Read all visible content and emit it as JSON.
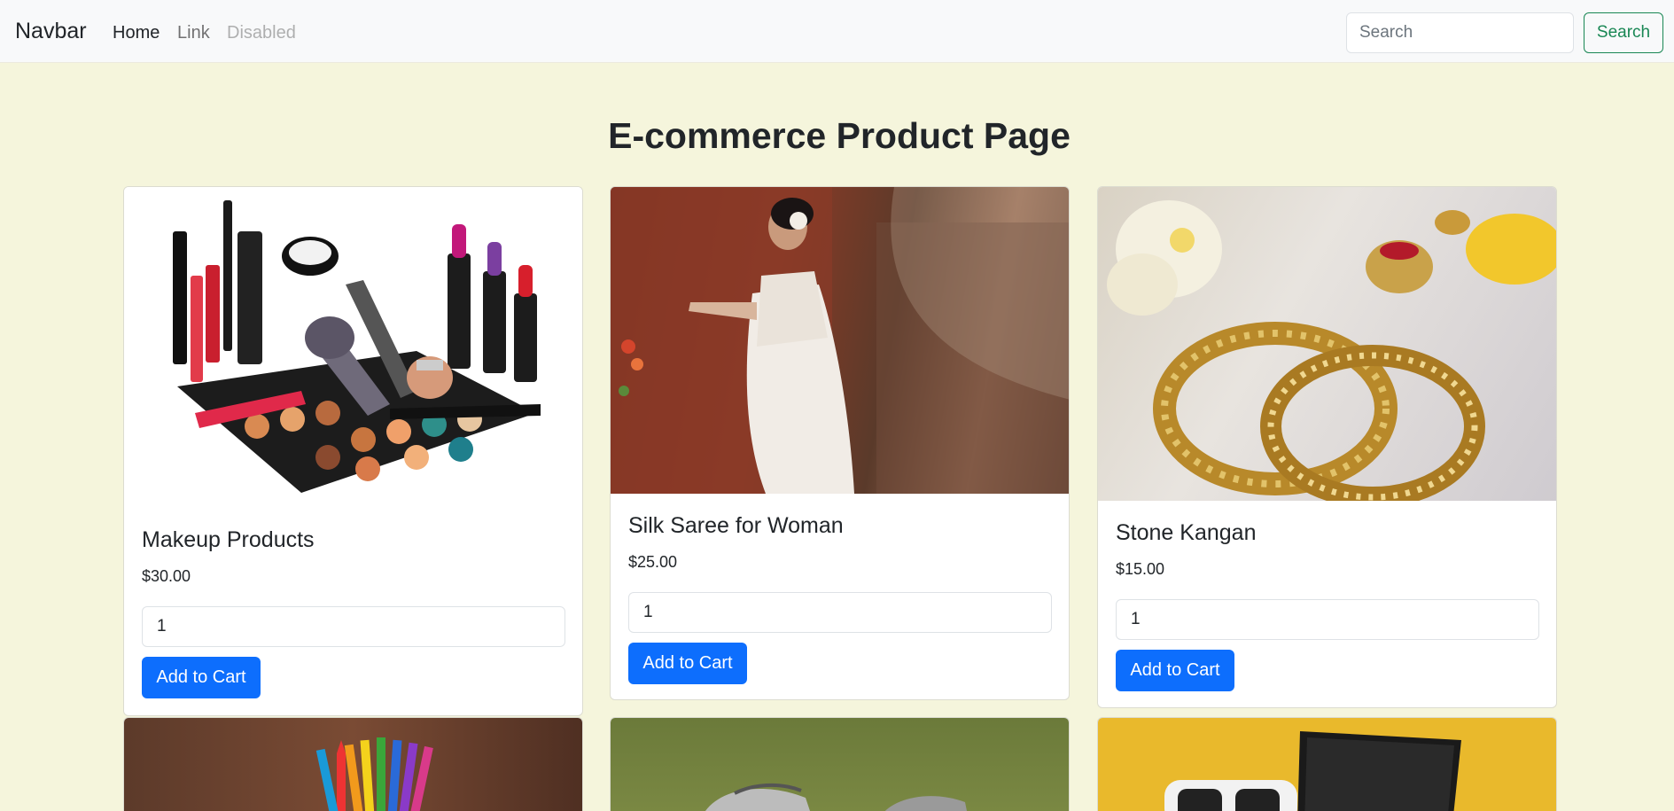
{
  "navbar": {
    "brand": "Navbar",
    "links": [
      {
        "label": "Home",
        "state": "active"
      },
      {
        "label": "Link",
        "state": "normal"
      },
      {
        "label": "Disabled",
        "state": "disabled"
      }
    ],
    "search_placeholder": "Search",
    "search_button": "Search"
  },
  "page_title": "E-commerce Product Page",
  "products": [
    {
      "name": "Makeup Products",
      "price": "$30.00",
      "quantity": "1",
      "button": "Add to Cart",
      "image": "makeup-products-image"
    },
    {
      "name": "Silk Saree for Woman",
      "price": "$25.00",
      "quantity": "1",
      "button": "Add to Cart",
      "image": "silk-saree-image"
    },
    {
      "name": "Stone Kangan",
      "price": "$15.00",
      "quantity": "1",
      "button": "Add to Cart",
      "image": "stone-kangan-image"
    }
  ],
  "partial_products": [
    "colored-pencils-image",
    "sneakers-image",
    "vr-headset-laptop-image"
  ],
  "colors": {
    "page_background": "#f5f5dc",
    "navbar_background": "#f8f9fa",
    "primary": "#0d6efd",
    "success": "#198754"
  }
}
